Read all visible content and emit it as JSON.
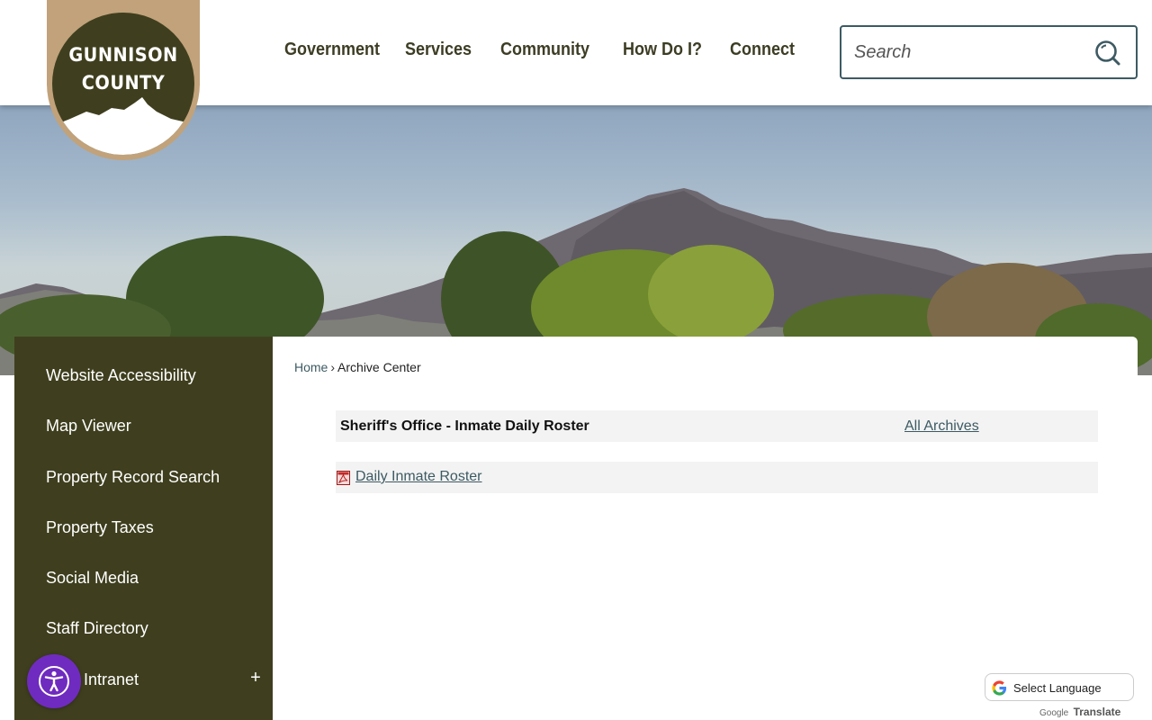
{
  "logo": {
    "line1": "GUNNISON",
    "line2": "COUNTY"
  },
  "nav": {
    "items": [
      {
        "label": "Government"
      },
      {
        "label": "Services"
      },
      {
        "label": "Community"
      },
      {
        "label": "How Do I?"
      },
      {
        "label": "Connect"
      }
    ]
  },
  "search": {
    "placeholder": "Search",
    "icon": "search-icon"
  },
  "sidebar": {
    "items": [
      {
        "label": "Website Accessibility"
      },
      {
        "label": "Map Viewer"
      },
      {
        "label": "Property Record Search"
      },
      {
        "label": "Property Taxes"
      },
      {
        "label": "Social Media"
      },
      {
        "label": "Staff Directory"
      },
      {
        "label": "Intranet"
      }
    ],
    "expand_symbol": "+"
  },
  "breadcrumb": {
    "home": "Home",
    "separator": "›",
    "current": "Archive Center"
  },
  "archive": {
    "title": "Sheriff's Office - Inmate Daily Roster",
    "all_archives": "All Archives",
    "rows": [
      {
        "label": "Daily Inmate Roster",
        "icon": "pdf-icon"
      }
    ]
  },
  "translate": {
    "select_label": "Select Language",
    "powered_by": "Google",
    "translate_word": "Translate"
  },
  "colors": {
    "brand_dark": "#3f3f1f",
    "brand_tan": "#c1a27a",
    "link": "#3d5a63",
    "accessibility_purple": "#6f2bbf"
  }
}
